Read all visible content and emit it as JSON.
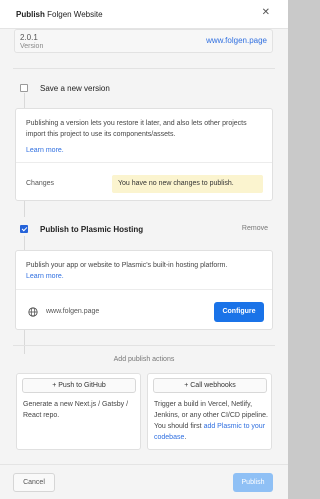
{
  "header": {
    "title_prefix": "Publish",
    "title_project": "Folgen Website",
    "close_icon": "close-icon"
  },
  "version": {
    "number": "2.0.1",
    "label": "Version",
    "domain_link": "www.folgen.page"
  },
  "save_version": {
    "checked": false,
    "title": "Save a new version",
    "description": "Publishing a version lets you restore it later, and also lets other projects import this project to use its components/assets.",
    "learn_more": "Learn more.",
    "changes_label": "Changes",
    "changes_note": "You have no new changes to publish."
  },
  "plasmic_hosting": {
    "checked": true,
    "title": "Publish to Plasmic Hosting",
    "remove_label": "Remove",
    "description": "Publish your app or website to Plasmic's built-in hosting platform.",
    "learn_more": "Learn more.",
    "domain": "www.folgen.page",
    "domain_icon": "globe-icon",
    "configure_label": "Configure"
  },
  "add_actions": {
    "heading": "Add publish actions",
    "github": {
      "button_label": "+ Push to GitHub",
      "description": "Generate a new Next.js / Gatsby / React repo."
    },
    "webhooks": {
      "button_label": "+ Call webhooks",
      "description": "Trigger a build in Vercel, Netlify, Jenkins, or any other CI/CD pipeline. You should first",
      "link": "add Plasmic to your codebase",
      "suffix": "."
    }
  },
  "footer": {
    "cancel_label": "Cancel",
    "publish_label": "Publish"
  },
  "colors": {
    "accent": "#1a73e8",
    "link": "#2f6fe0",
    "note_bg": "#fbf4cf",
    "publish_disabled": "#8fc0f5"
  }
}
